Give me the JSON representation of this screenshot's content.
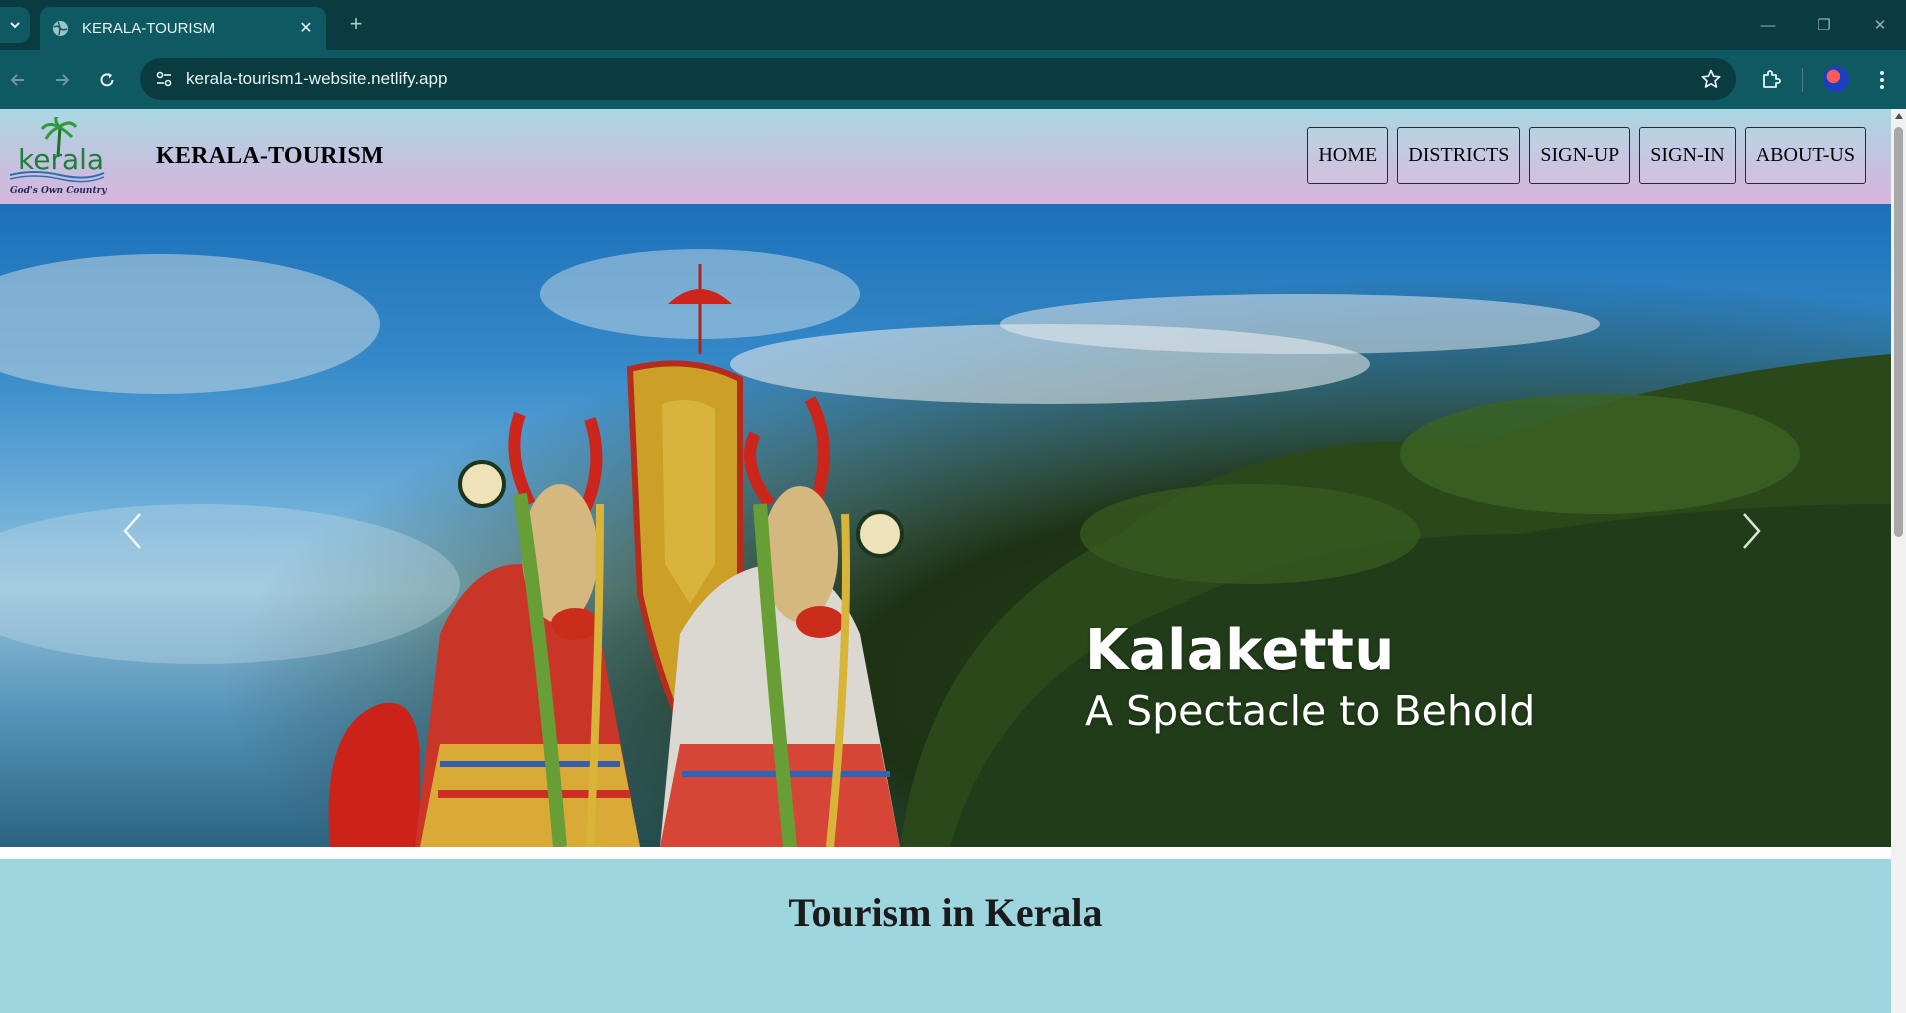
{
  "browser": {
    "tab_title": "KERALA-TOURISM",
    "url": "kerala-tourism1-website.netlify.app"
  },
  "site": {
    "logo_text": "kerala",
    "logo_tagline": "God's Own Country",
    "title": "KERALA-TOURISM",
    "nav": [
      {
        "label": "HOME"
      },
      {
        "label": "DISTRICTS"
      },
      {
        "label": "SIGN-UP"
      },
      {
        "label": "SIGN-IN"
      },
      {
        "label": "ABOUT-US"
      }
    ]
  },
  "hero": {
    "caption_title": "Kalakettu",
    "caption_subtitle": "A Spectacle to Behold"
  },
  "section": {
    "title": "Tourism in Kerala"
  },
  "colors": {
    "chrome_dark": "#0a3b41",
    "chrome_mid": "#0f5a62",
    "page_bg": "#9dd6df"
  }
}
